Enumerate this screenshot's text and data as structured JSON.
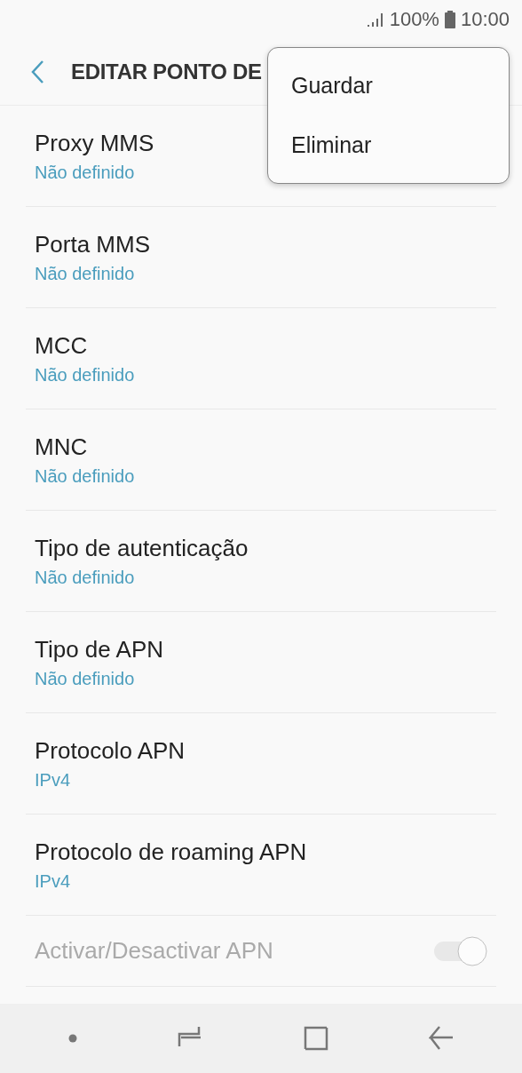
{
  "status_bar": {
    "battery": "100%",
    "time": "10:00"
  },
  "header": {
    "title": "EDITAR PONTO DE"
  },
  "menu": {
    "items": [
      "Guardar",
      "Eliminar"
    ]
  },
  "settings": [
    {
      "kind": "value",
      "label": "Proxy MMS",
      "value": "Não definido"
    },
    {
      "kind": "value",
      "label": "Porta MMS",
      "value": "Não definido"
    },
    {
      "kind": "value",
      "label": "MCC",
      "value": "Não definido"
    },
    {
      "kind": "value",
      "label": "MNC",
      "value": "Não definido"
    },
    {
      "kind": "value",
      "label": "Tipo de autenticação",
      "value": "Não definido"
    },
    {
      "kind": "value",
      "label": "Tipo de APN",
      "value": "Não definido"
    },
    {
      "kind": "value",
      "label": "Protocolo APN",
      "value": "IPv4"
    },
    {
      "kind": "value",
      "label": "Protocolo de roaming APN",
      "value": "IPv4"
    },
    {
      "kind": "toggle",
      "label": "Activar/Desactivar APN",
      "on": true,
      "disabled": true
    }
  ]
}
